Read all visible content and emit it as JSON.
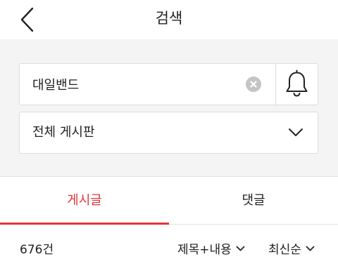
{
  "header": {
    "title": "검색"
  },
  "search": {
    "value": "대일밴드",
    "placeholder": ""
  },
  "board_select": {
    "selected": "전체 게시판"
  },
  "tabs": [
    {
      "label": "게시글",
      "active": true
    },
    {
      "label": "댓글",
      "active": false
    }
  ],
  "results": {
    "count_label": "676건",
    "scope_filter": "제목+내용",
    "sort_filter": "최신순"
  },
  "colors": {
    "accent": "#e5343b",
    "panel_background": "#f4f4f4",
    "border": "#dcdcdc",
    "clear_icon": "#c4c4c4"
  },
  "icons": {
    "back": "chevron-left-icon",
    "clear": "clear-circle-icon",
    "bell": "bell-icon",
    "dropdown": "chevron-down-icon"
  }
}
